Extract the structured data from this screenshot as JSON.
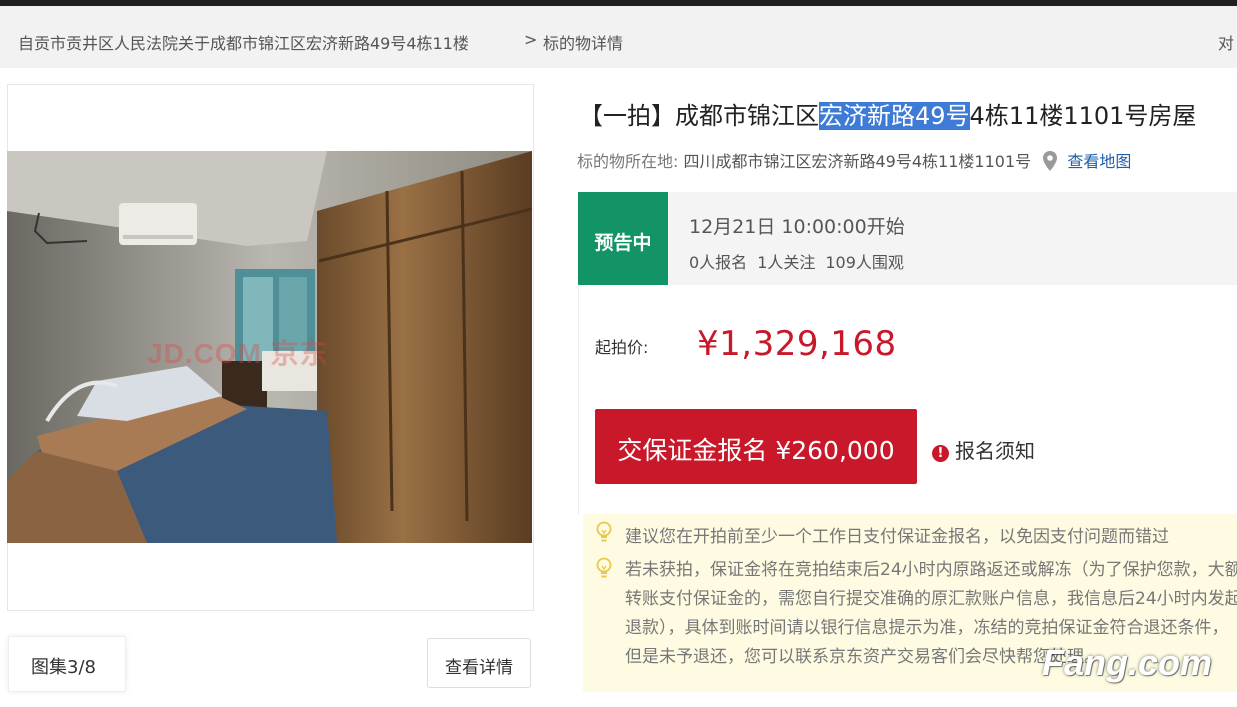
{
  "breadcrumb": {
    "court_link": "自贡市贡井区人民法院关于成都市锦江区宏济新路49号4栋11楼",
    "separator": ">",
    "current": "标的物详情",
    "right_cut": "对"
  },
  "gallery": {
    "watermark": "JD.COM 京东",
    "counter": "图集3/8",
    "detail_button": "查看详情"
  },
  "item": {
    "title_prefix": "【一拍】成都市锦江区",
    "title_highlight": "宏济新路49号",
    "title_suffix": "4栋11楼1101号房屋",
    "address_label": "标的物所在地:",
    "address_value": "四川成都市锦江区宏济新路49号4栋11楼1101号",
    "map_link": "查看地图",
    "location_icon": "location-pin-icon"
  },
  "status": {
    "badge": "预告中",
    "start_time": "12月21日 10:00:00开始",
    "signups": "0人报名",
    "followers": "1人关注",
    "viewers": "109人围观"
  },
  "pricing": {
    "start_price_label": "起拍价:",
    "start_price": "¥1,329,168",
    "deposit_button": "交保证金报名 ¥260,000",
    "notice_icon": "!",
    "notice_link": "报名须知"
  },
  "tips": {
    "icon": "lightbulb-icon",
    "tip1": "建议您在开拍前至少一个工作日支付保证金报名，以免因支付问题而错过",
    "tip2": "若未获拍，保证金将在竞拍结束后24小时内原路返还或解冻（为了保护您款，大额转账支付保证金的，需您自行提交准确的原汇款账户信息，我信息后24小时内发起退款），具体到账时间请以银行信息提示为准，冻结的竞拍保证金符合退还条件，但是未予退还，您可以联系京东资产交易客们会尽快帮您处理。"
  },
  "watermark_site": "Fang.com",
  "colors": {
    "accent_red": "#c8182a",
    "badge_green": "#129466",
    "link_blue": "#1f5fa8",
    "highlight_blue": "#3e7bd6",
    "tip_bg": "#fefbe2"
  }
}
